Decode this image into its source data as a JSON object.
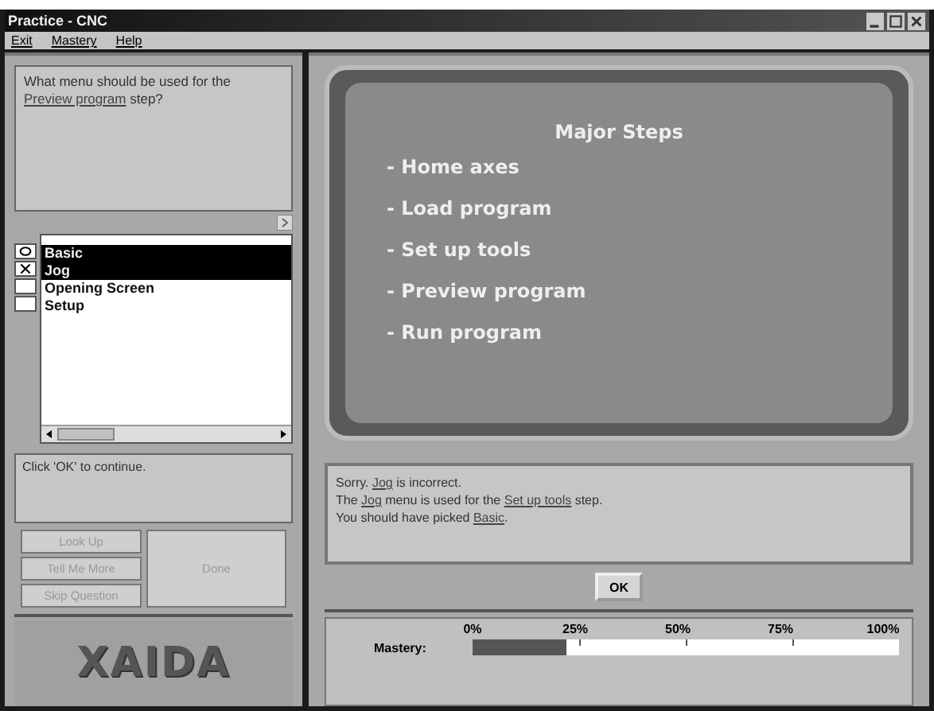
{
  "window": {
    "title": "Practice - CNC"
  },
  "menu": [
    "Exit",
    "Mastery",
    "Help"
  ],
  "question": [
    {
      "text": "What menu should be used for the ",
      "link": false
    },
    {
      "text": "Preview program",
      "link": true
    },
    {
      "text": " step?",
      "link": false
    }
  ],
  "answers": [
    {
      "label": "Basic",
      "selected": true,
      "kind": "circle"
    },
    {
      "label": "Jog",
      "selected": true,
      "kind": "cross"
    },
    {
      "label": "Opening Screen",
      "selected": false,
      "kind": "blank"
    },
    {
      "label": "Setup",
      "selected": false,
      "kind": "blank"
    }
  ],
  "instruction": "Click 'OK' to continue.",
  "side_buttons": [
    {
      "label": "Look Up",
      "disabled": true
    },
    {
      "label": "Tell Me More",
      "disabled": true
    },
    {
      "label": "Skip Question",
      "disabled": true
    }
  ],
  "done_button": {
    "label": "Done",
    "disabled": true
  },
  "logo": "XAIDA",
  "board": {
    "title": "Major Steps",
    "items": [
      "- Home axes",
      "- Load program",
      "- Set up tools",
      "- Preview program",
      "- Run program"
    ]
  },
  "feedback": [
    [
      {
        "text": "Sorry. ",
        "link": false
      },
      {
        "text": "Jog",
        "link": true
      },
      {
        "text": " is incorrect.",
        "link": false
      }
    ],
    [
      {
        "text": "The ",
        "link": false
      },
      {
        "text": "Jog",
        "link": true
      },
      {
        "text": " menu is used for the ",
        "link": false
      },
      {
        "text": "Set up tools",
        "link": true
      },
      {
        "text": " step.",
        "link": false
      }
    ],
    [
      {
        "text": "You should have picked ",
        "link": false
      },
      {
        "text": "Basic",
        "link": true
      },
      {
        "text": ".",
        "link": false
      }
    ]
  ],
  "ok_button": "OK",
  "mastery": {
    "label": "Mastery:",
    "level": 0.22,
    "ticks": [
      "0%",
      "25%",
      "50%",
      "75%",
      "100%"
    ]
  }
}
